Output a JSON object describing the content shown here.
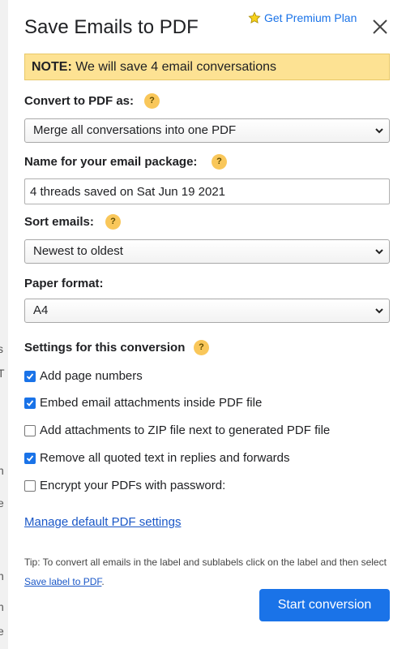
{
  "header": {
    "title": "Save Emails to PDF",
    "premium_link": "Get Premium Plan",
    "premium_icon": "star-icon",
    "close_icon": "close-icon"
  },
  "note": {
    "prefix": "NOTE:",
    "text": " We will save 4 email conversations"
  },
  "help_glyph": "?",
  "convert": {
    "label": "Convert to PDF as:",
    "selected": "Merge all conversations into one PDF"
  },
  "package_name": {
    "label": "Name for your email package:",
    "value": "4 threads saved on Sat Jun 19 2021"
  },
  "sort": {
    "label": "Sort emails:",
    "selected": "Newest to oldest"
  },
  "paper": {
    "label": "Paper format:",
    "selected": "A4"
  },
  "settings": {
    "label": "Settings for this conversion",
    "options": [
      {
        "label": "Add page numbers",
        "checked": true
      },
      {
        "label": "Embed email attachments inside PDF file",
        "checked": true
      },
      {
        "label": "Add attachments to ZIP file next to generated PDF file",
        "checked": false
      },
      {
        "label": "Remove all quoted text in replies and forwards",
        "checked": true
      },
      {
        "label": "Encrypt your PDFs with password:",
        "checked": false
      }
    ]
  },
  "manage_link": "Manage default PDF settings",
  "tip": {
    "text": "Tip: To convert all emails in the label and sublabels click on the label and then select ",
    "link": "Save label to PDF",
    "suffix": "."
  },
  "start_button": "Start conversion",
  "colors": {
    "accent": "#1a73e8",
    "note_bg": "#fde293",
    "help_badge": "#f9c75a"
  },
  "background_fragments": [
    "s",
    "T",
    "h",
    "e",
    "n",
    "h",
    "e"
  ]
}
